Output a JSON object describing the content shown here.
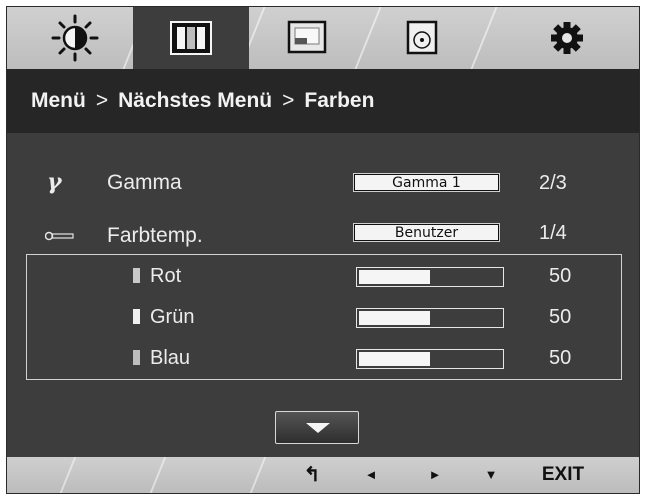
{
  "tabs": [
    {
      "name": "brightness-icon",
      "active": false
    },
    {
      "name": "color-bars-icon",
      "active": true
    },
    {
      "name": "picture-icon",
      "active": false
    },
    {
      "name": "disc-icon",
      "active": false
    },
    {
      "name": "gear-icon",
      "active": false
    }
  ],
  "breadcrumb": {
    "item1": "Menü",
    "sep1": ">",
    "item2": "Nächstes Menü",
    "sep2": ">",
    "item3": "Farben"
  },
  "gamma": {
    "icon": "γ",
    "label": "Gamma",
    "value": "Gamma 1",
    "count": "2/3"
  },
  "colortemp": {
    "icon": "thermometer-icon",
    "label": "Farbtemp.",
    "value": "Benutzer",
    "count": "1/4"
  },
  "channels": [
    {
      "label": "Rot",
      "value": "50",
      "level_percent": 50,
      "swatch": "#c9c9c9"
    },
    {
      "label": "Grün",
      "value": "50",
      "level_percent": 50,
      "swatch": "#f0f0f0"
    },
    {
      "label": "Blau",
      "value": "50",
      "level_percent": 50,
      "swatch": "#bdbdbd"
    }
  ],
  "footer": {
    "back_glyph": "↰",
    "left_glyph": "◄",
    "right_glyph": "►",
    "down_glyph": "▼",
    "exit_label": "EXIT"
  }
}
